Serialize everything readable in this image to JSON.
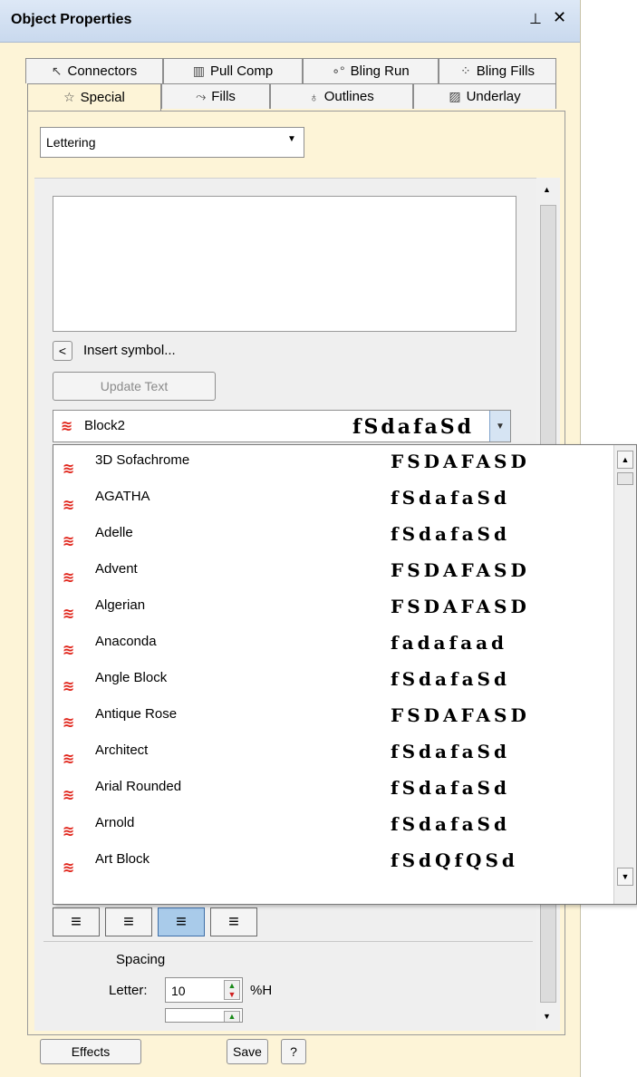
{
  "window": {
    "title": "Object Properties",
    "pin_icon": "pin-icon",
    "close_icon": "close-icon"
  },
  "tabs_row1": [
    {
      "label": "Connectors",
      "icon": "connector-icon"
    },
    {
      "label": "Pull Comp",
      "icon": "pull-comp-icon"
    },
    {
      "label": "Bling Run",
      "icon": "bling-run-icon"
    },
    {
      "label": "Bling Fills",
      "icon": "bling-fills-icon"
    }
  ],
  "tabs_row2": [
    {
      "label": "Special",
      "icon": "star-icon",
      "selected": true
    },
    {
      "label": "Fills",
      "icon": "fill-icon"
    },
    {
      "label": "Outlines",
      "icon": "outline-icon"
    },
    {
      "label": "Underlay",
      "icon": "underlay-icon"
    }
  ],
  "object_type": {
    "value": "Lettering"
  },
  "lettering": {
    "text_value": "",
    "insert_symbol_button": "<",
    "insert_symbol_label": "Insert symbol...",
    "update_text_button": "Update Text"
  },
  "font_select": {
    "selected": "Block2",
    "sample": "fSdafaSd"
  },
  "font_list": [
    {
      "name": "3D Sofachrome",
      "sample": "FSDAFASD"
    },
    {
      "name": "AGATHA",
      "sample": "fSdafaSd"
    },
    {
      "name": "Adelle",
      "sample": "fSdafaSd"
    },
    {
      "name": "Advent",
      "sample": "FSDAFASD"
    },
    {
      "name": "Algerian",
      "sample": "FSDAFASD"
    },
    {
      "name": "Anaconda",
      "sample": "fadafaad"
    },
    {
      "name": "Angle Block",
      "sample": "fSdafaSd"
    },
    {
      "name": "Antique Rose",
      "sample": "FSDAFASD"
    },
    {
      "name": "Architect",
      "sample": "fSdafaSd"
    },
    {
      "name": "Arial Rounded",
      "sample": "fSdafaSd"
    },
    {
      "name": "Arnold",
      "sample": "fSdafaSd"
    },
    {
      "name": "Art Block",
      "sample": "fSdQfQSd"
    }
  ],
  "spacing": {
    "heading": "Spacing",
    "letter_label": "Letter:",
    "letter_value": "10",
    "letter_unit": "%H",
    "line_value": ""
  },
  "footer": {
    "effects_button": "Effects",
    "save_button": "Save",
    "help_button": "?"
  },
  "colors": {
    "panel_bg": "#fdf4d7",
    "accent_blue": "#a9cbea",
    "stitch_red": "#e0241a"
  }
}
